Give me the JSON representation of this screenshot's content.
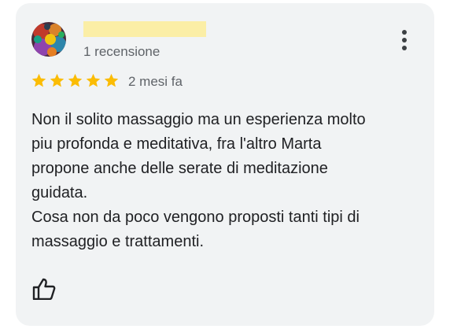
{
  "review": {
    "reviewer_stats": "1 recensione",
    "rating": 5,
    "rating_max": 5,
    "date": "2 mesi fa",
    "text": "Non il solito massaggio ma un esperienza molto\npiu profonda e meditativa, fra l'altro Marta\npropone anche delle serate di meditazione\nguidata.\nCosa non da poco vengono proposti tanti tipi di\nmassaggio e trattamenti."
  },
  "icons": {
    "more": "more-vert-icon",
    "like": "thumb-up-icon",
    "star": "star-icon"
  },
  "colors": {
    "card_background": "#f1f3f4",
    "star": "#fbbc04",
    "redaction": "#fbeea6",
    "text_primary": "#202124",
    "text_secondary": "#5f6368"
  }
}
